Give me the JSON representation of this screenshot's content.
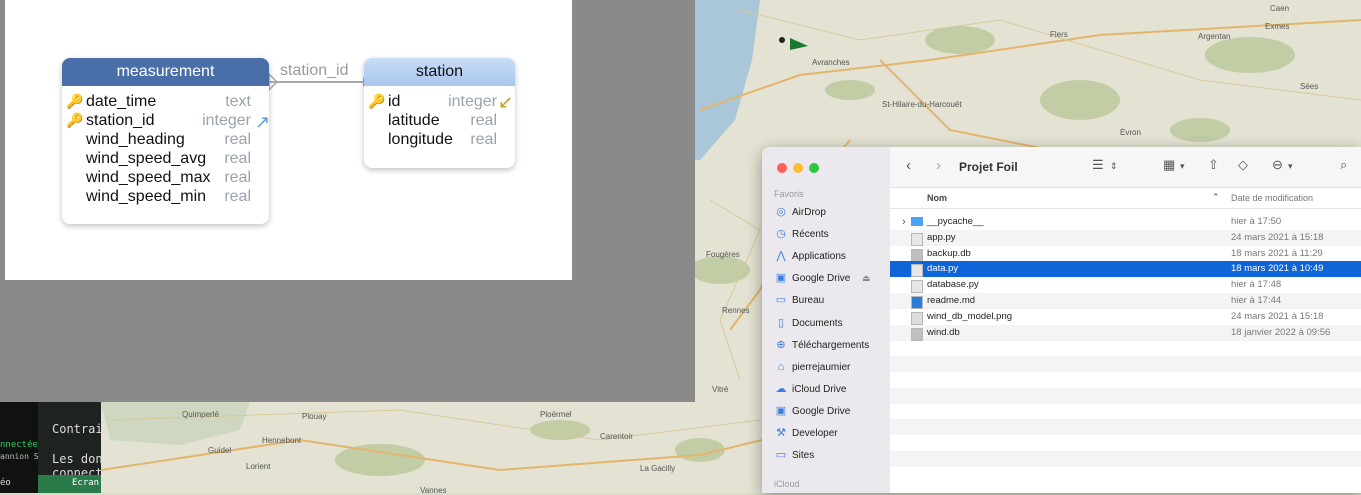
{
  "diagram": {
    "measurement": {
      "title": "measurement",
      "fields": [
        {
          "name": "date_time",
          "type": "text",
          "key": true
        },
        {
          "name": "station_id",
          "type": "integer",
          "key": true
        },
        {
          "name": "wind_heading",
          "type": "real",
          "key": false
        },
        {
          "name": "wind_speed_avg",
          "type": "real",
          "key": false
        },
        {
          "name": "wind_speed_max",
          "type": "real",
          "key": false
        },
        {
          "name": "wind_speed_min",
          "type": "real",
          "key": false
        }
      ]
    },
    "station": {
      "title": "station",
      "fields": [
        {
          "name": "id",
          "type": "integer",
          "key": true
        },
        {
          "name": "latitude",
          "type": "real",
          "key": false
        },
        {
          "name": "longitude",
          "type": "real",
          "key": false
        }
      ]
    },
    "relation_label": "station_id"
  },
  "map": {
    "labels": [
      "Flers",
      "Avranches",
      "Argentan",
      "St-Hilaire-du-Harcouët",
      "Vitré",
      "Rennes",
      "Quimperlé",
      "Hennebont",
      "Lorient",
      "Guidel",
      "Vannes",
      "Caen",
      "Exmes",
      "Sées",
      "Carentoir",
      "La Gacilly",
      "Plouay",
      "Ploërmel",
      "Fougères",
      "Évron"
    ]
  },
  "terminal": {
    "status": "nnectée",
    "sub": "annion Sir",
    "line1": "Contrai",
    "line2": "Les don",
    "line3": "connect",
    "footer": "éo",
    "tab": "Ecran"
  },
  "finder": {
    "title": "Projet Foil",
    "sidebar": {
      "favorites_header": "Favoris",
      "items": [
        {
          "label": "AirDrop",
          "icon": "airdrop-icon",
          "glyph": "◎"
        },
        {
          "label": "Récents",
          "icon": "clock-icon",
          "glyph": "◷"
        },
        {
          "label": "Applications",
          "icon": "applications-icon",
          "glyph": "⋀"
        },
        {
          "label": "Google Drive",
          "icon": "drive-icon",
          "glyph": "▣"
        },
        {
          "label": "Bureau",
          "icon": "desktop-icon",
          "glyph": "▭"
        },
        {
          "label": "Documents",
          "icon": "document-icon",
          "glyph": "▯"
        },
        {
          "label": "Téléchargements",
          "icon": "download-icon",
          "glyph": "⊕"
        },
        {
          "label": "pierrejaumier",
          "icon": "home-icon",
          "glyph": "⌂"
        },
        {
          "label": "iCloud Drive",
          "icon": "cloud-icon",
          "glyph": "☁"
        },
        {
          "label": "Google Drive",
          "icon": "drive-icon",
          "glyph": "▣"
        },
        {
          "label": "Developer",
          "icon": "hammer-icon",
          "glyph": "⚒"
        },
        {
          "label": "Sites",
          "icon": "folder-icon",
          "glyph": "▭"
        }
      ],
      "icloud_header": "iCloud",
      "eject_glyph": "⏏"
    },
    "columns": {
      "name": "Nom",
      "date": "Date de modification"
    },
    "files": [
      {
        "name": "__pycache__",
        "date": "hier à 17:50",
        "kind": "folder",
        "selected": false
      },
      {
        "name": "app.py",
        "date": "24 mars 2021 à 15:18",
        "kind": "file",
        "selected": false
      },
      {
        "name": "backup.db",
        "date": "18 mars 2021 à 11:29",
        "kind": "db",
        "selected": false
      },
      {
        "name": "data.py",
        "date": "18 mars 2021 à 10:49",
        "kind": "file",
        "selected": true
      },
      {
        "name": "database.py",
        "date": "hier à 17:48",
        "kind": "file",
        "selected": false
      },
      {
        "name": "readme.md",
        "date": "hier à 17:44",
        "kind": "md",
        "selected": false
      },
      {
        "name": "wind_db_model.png",
        "date": "24 mars 2021 à 15:18",
        "kind": "image",
        "selected": false
      },
      {
        "name": "wind.db",
        "date": "18 janvier 2022 à 09:56",
        "kind": "db",
        "selected": false
      }
    ],
    "toolbar_icons": [
      "back-icon",
      "forward-icon",
      "list-view-icon",
      "grid-view-icon",
      "share-icon",
      "tag-icon",
      "more-icon",
      "search-icon"
    ],
    "colors": {
      "selection": "#0f64d8",
      "sidebar": "#ece9ee"
    }
  }
}
